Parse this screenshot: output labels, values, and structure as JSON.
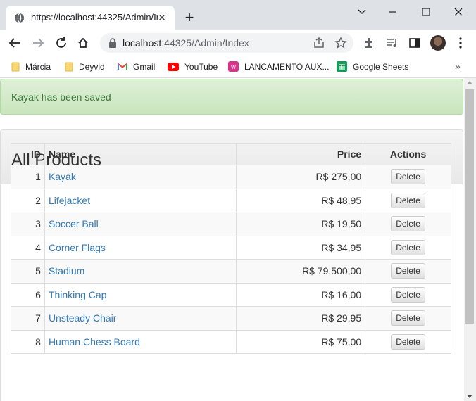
{
  "browser": {
    "tab_title": "https://localhost:44325/Admin/In",
    "url_host": "localhost",
    "url_path": ":44325/Admin/Index",
    "bookmarks": [
      {
        "label": "Márcia",
        "icon": "folder-icon"
      },
      {
        "label": "Deyvid",
        "icon": "folder-icon"
      },
      {
        "label": "Gmail",
        "icon": "gmail-icon"
      },
      {
        "label": "YouTube",
        "icon": "youtube-icon"
      },
      {
        "label": "LANCAMENTO AUX...",
        "icon": "wm-icon"
      },
      {
        "label": "Google Sheets",
        "icon": "sheets-icon"
      }
    ]
  },
  "alert": {
    "message": "Kayak has been saved"
  },
  "panel": {
    "title": "All Products"
  },
  "table": {
    "headers": {
      "id": "ID",
      "name": "Name",
      "price": "Price",
      "actions": "Actions"
    },
    "delete_label": "Delete",
    "rows": [
      {
        "id": "1",
        "name": "Kayak",
        "price": "R$ 275,00"
      },
      {
        "id": "2",
        "name": "Lifejacket",
        "price": "R$ 48,95"
      },
      {
        "id": "3",
        "name": "Soccer Ball",
        "price": "R$ 19,50"
      },
      {
        "id": "4",
        "name": "Corner Flags",
        "price": "R$ 34,95"
      },
      {
        "id": "5",
        "name": "Stadium",
        "price": "R$ 79.500,00"
      },
      {
        "id": "6",
        "name": "Thinking Cap",
        "price": "R$ 16,00"
      },
      {
        "id": "7",
        "name": "Unsteady Chair",
        "price": "R$ 29,95"
      },
      {
        "id": "8",
        "name": "Human Chess Board",
        "price": "R$ 75,00"
      }
    ]
  }
}
